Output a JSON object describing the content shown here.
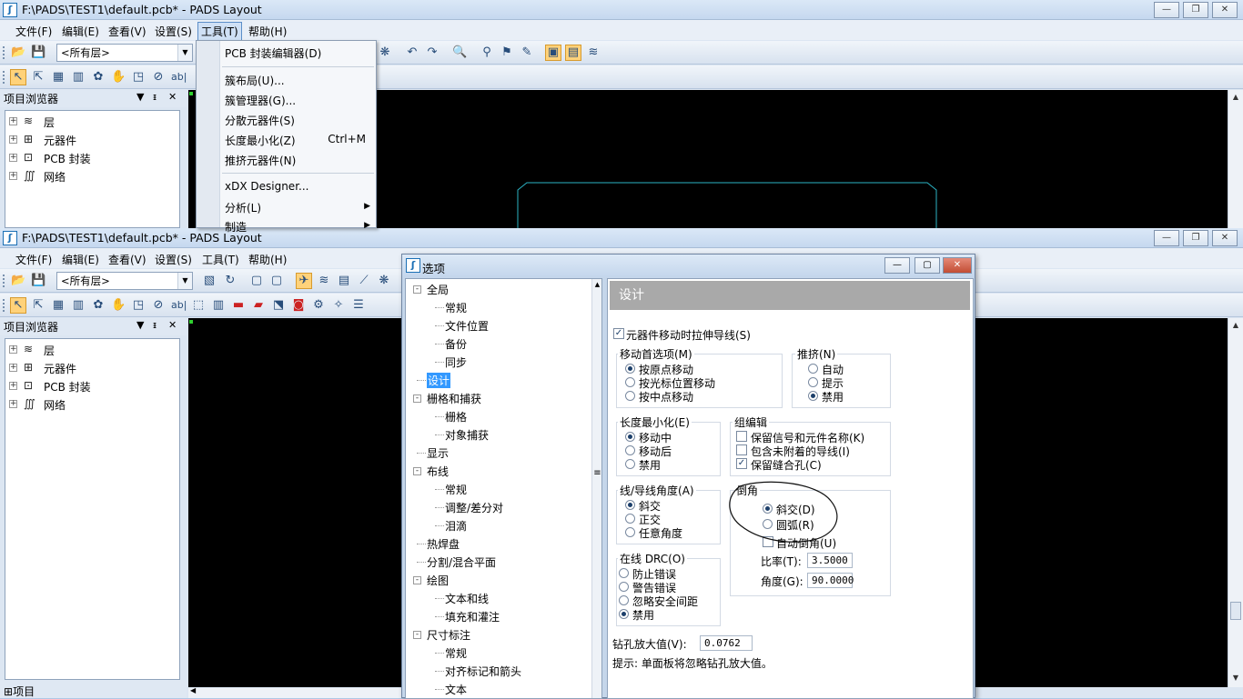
{
  "window1": {
    "title": "F:\\PADS\\TEST1\\default.pcb* - PADS Layout",
    "menus": [
      "文件(F)",
      "编辑(E)",
      "查看(V)",
      "设置(S)",
      "工具(T)",
      "帮助(H)"
    ],
    "layer_combo": "<所有层>",
    "browser_title": "项目浏览器",
    "tree": [
      "层",
      "元器件",
      "PCB 封装",
      "网络"
    ]
  },
  "tools_menu": {
    "items": [
      {
        "label": "PCB 封装编辑器(D)",
        "shortcut": "",
        "submenu": false
      },
      {
        "label": "簇布局(U)...",
        "shortcut": "",
        "submenu": false
      },
      {
        "label": "簇管理器(G)...",
        "shortcut": "",
        "submenu": false
      },
      {
        "label": "分散元器件(S)",
        "shortcut": "",
        "submenu": false
      },
      {
        "label": "长度最小化(Z)",
        "shortcut": "Ctrl+M",
        "submenu": false
      },
      {
        "label": "推挤元器件(N)",
        "shortcut": "",
        "submenu": false
      },
      {
        "label": "xDX Designer...",
        "shortcut": "",
        "submenu": false
      },
      {
        "label": "分析(L)",
        "shortcut": "",
        "submenu": true
      },
      {
        "label": "制造",
        "shortcut": "",
        "submenu": true
      }
    ]
  },
  "window2": {
    "title": "F:\\PADS\\TEST1\\default.pcb* - PADS Layout",
    "menus": [
      "文件(F)",
      "编辑(E)",
      "查看(V)",
      "设置(S)",
      "工具(T)",
      "帮助(H)"
    ],
    "layer_combo": "<所有层>",
    "browser_title": "项目浏览器",
    "tree": [
      "层",
      "元器件",
      "PCB 封装",
      "网络"
    ],
    "status_tab": "项目"
  },
  "options_dialog": {
    "title": "选项",
    "nav": [
      {
        "label": "全局",
        "level": 0,
        "exp": "-"
      },
      {
        "label": "常规",
        "level": 1
      },
      {
        "label": "文件位置",
        "level": 1
      },
      {
        "label": "备份",
        "level": 1
      },
      {
        "label": "同步",
        "level": 1
      },
      {
        "label": "设计",
        "level": 0,
        "selected": true
      },
      {
        "label": "栅格和捕获",
        "level": 0,
        "exp": "-"
      },
      {
        "label": "栅格",
        "level": 1
      },
      {
        "label": "对象捕获",
        "level": 1
      },
      {
        "label": "显示",
        "level": 0
      },
      {
        "label": "布线",
        "level": 0,
        "exp": "-"
      },
      {
        "label": "常规",
        "level": 1
      },
      {
        "label": "调整/差分对",
        "level": 1
      },
      {
        "label": "泪滴",
        "level": 1
      },
      {
        "label": "热焊盘",
        "level": 0
      },
      {
        "label": "分割/混合平面",
        "level": 0
      },
      {
        "label": "绘图",
        "level": 0,
        "exp": "-"
      },
      {
        "label": "文本和线",
        "level": 1
      },
      {
        "label": "填充和灌注",
        "level": 1
      },
      {
        "label": "尺寸标注",
        "level": 0,
        "exp": "-"
      },
      {
        "label": "常规",
        "level": 1
      },
      {
        "label": "对齐标记和箭头",
        "level": 1
      },
      {
        "label": "文本",
        "level": 1
      }
    ],
    "panel_title": "设计",
    "stretch_traces": {
      "label": "元器件移动时拉伸导线(S)",
      "checked": true
    },
    "move_pref": {
      "title": "移动首选项(M)",
      "options": [
        "按原点移动",
        "按光标位置移动",
        "按中点移动"
      ],
      "selected": 0
    },
    "push": {
      "title": "推挤(N)",
      "options": [
        "自动",
        "提示",
        "禁用"
      ],
      "selected": 2
    },
    "length_min": {
      "title": "长度最小化(E)",
      "options": [
        "移动中",
        "移动后",
        "禁用"
      ],
      "selected": 0
    },
    "group_edit": {
      "title": "组编辑",
      "options": [
        {
          "label": "保留信号和元件名称(K)",
          "checked": false
        },
        {
          "label": "包含未附着的导线(I)",
          "checked": false
        },
        {
          "label": "保留缝合孔(C)",
          "checked": true
        }
      ]
    },
    "line_angle": {
      "title": "线/导线角度(A)",
      "options": [
        "斜交",
        "正交",
        "任意角度"
      ],
      "selected": 0
    },
    "chamfer": {
      "title": "倒角",
      "options": [
        "斜交(D)",
        "圆弧(R)"
      ],
      "selected": 0,
      "auto_label": "自动倒角(U)",
      "auto_checked": false,
      "ratio_label": "比率(T):",
      "ratio_value": "3.5000",
      "angle_label": "角度(G):",
      "angle_value": "90.0000"
    },
    "online_drc": {
      "title": "在线 DRC(O)",
      "options": [
        "防止错误",
        "警告错误",
        "忽略安全间距",
        "禁用"
      ],
      "selected": 3
    },
    "drill_oversize_label": "钻孔放大值(V):",
    "drill_oversize_value": "0.0762",
    "hint": "提示: 单面板将忽略钻孔放大值。"
  },
  "colors": {
    "canvas": "#000000",
    "outline": "#2bb3c4",
    "nav_selected": "#3399ff",
    "panel_header": "#a9a9a9"
  }
}
